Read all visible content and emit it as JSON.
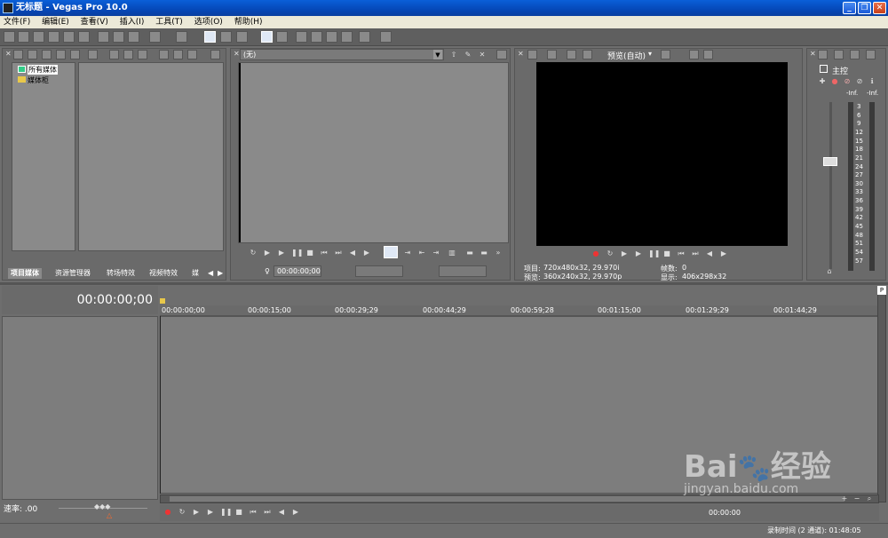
{
  "window": {
    "title": "无标题 - Vegas Pro 10.0"
  },
  "menu": [
    "文件(F)",
    "编辑(E)",
    "查看(V)",
    "插入(I)",
    "工具(T)",
    "选项(O)",
    "帮助(H)"
  ],
  "explorer": {
    "tree": [
      "所有媒体",
      "媒体柜"
    ],
    "tabs": [
      "项目媒体",
      "资源管理器",
      "转场特效",
      "视频特效",
      "媒"
    ]
  },
  "trimmer": {
    "dropdown": "(无)",
    "timecode": "00:00:00;00"
  },
  "preview": {
    "mode": "预览(自动)",
    "info": {
      "project_label": "项目:",
      "project_value": "720x480x32, 29.970i",
      "preview_label": "预览:",
      "preview_value": "360x240x32, 29.970p",
      "frame_label": "帧数:",
      "frame_value": "0",
      "display_label": "显示:",
      "display_value": "406x298x32"
    }
  },
  "master": {
    "label": "主控",
    "inf_left": "-Inf.",
    "inf_right": "-Inf.",
    "scale": [
      "3",
      "6",
      "9",
      "12",
      "15",
      "18",
      "21",
      "24",
      "27",
      "30",
      "33",
      "36",
      "39",
      "42",
      "45",
      "48",
      "51",
      "54",
      "57"
    ]
  },
  "timeline": {
    "cursor_time": "00:00:00;00",
    "ruler": [
      "00:00:00;00",
      "00:00:15;00",
      "00:00:29;29",
      "00:00:44;29",
      "00:00:59;28",
      "00:01:15;00",
      "00:01:29;29",
      "00:01:44;29"
    ],
    "rate_label": "速率: .00",
    "transport_time": "00:00:00"
  },
  "status": {
    "record_time": "录制时间 (2 通道): 01:48:05"
  },
  "watermark": {
    "brand": "Bai",
    "brand2": "经验",
    "url": "jingyan.baidu.com"
  }
}
